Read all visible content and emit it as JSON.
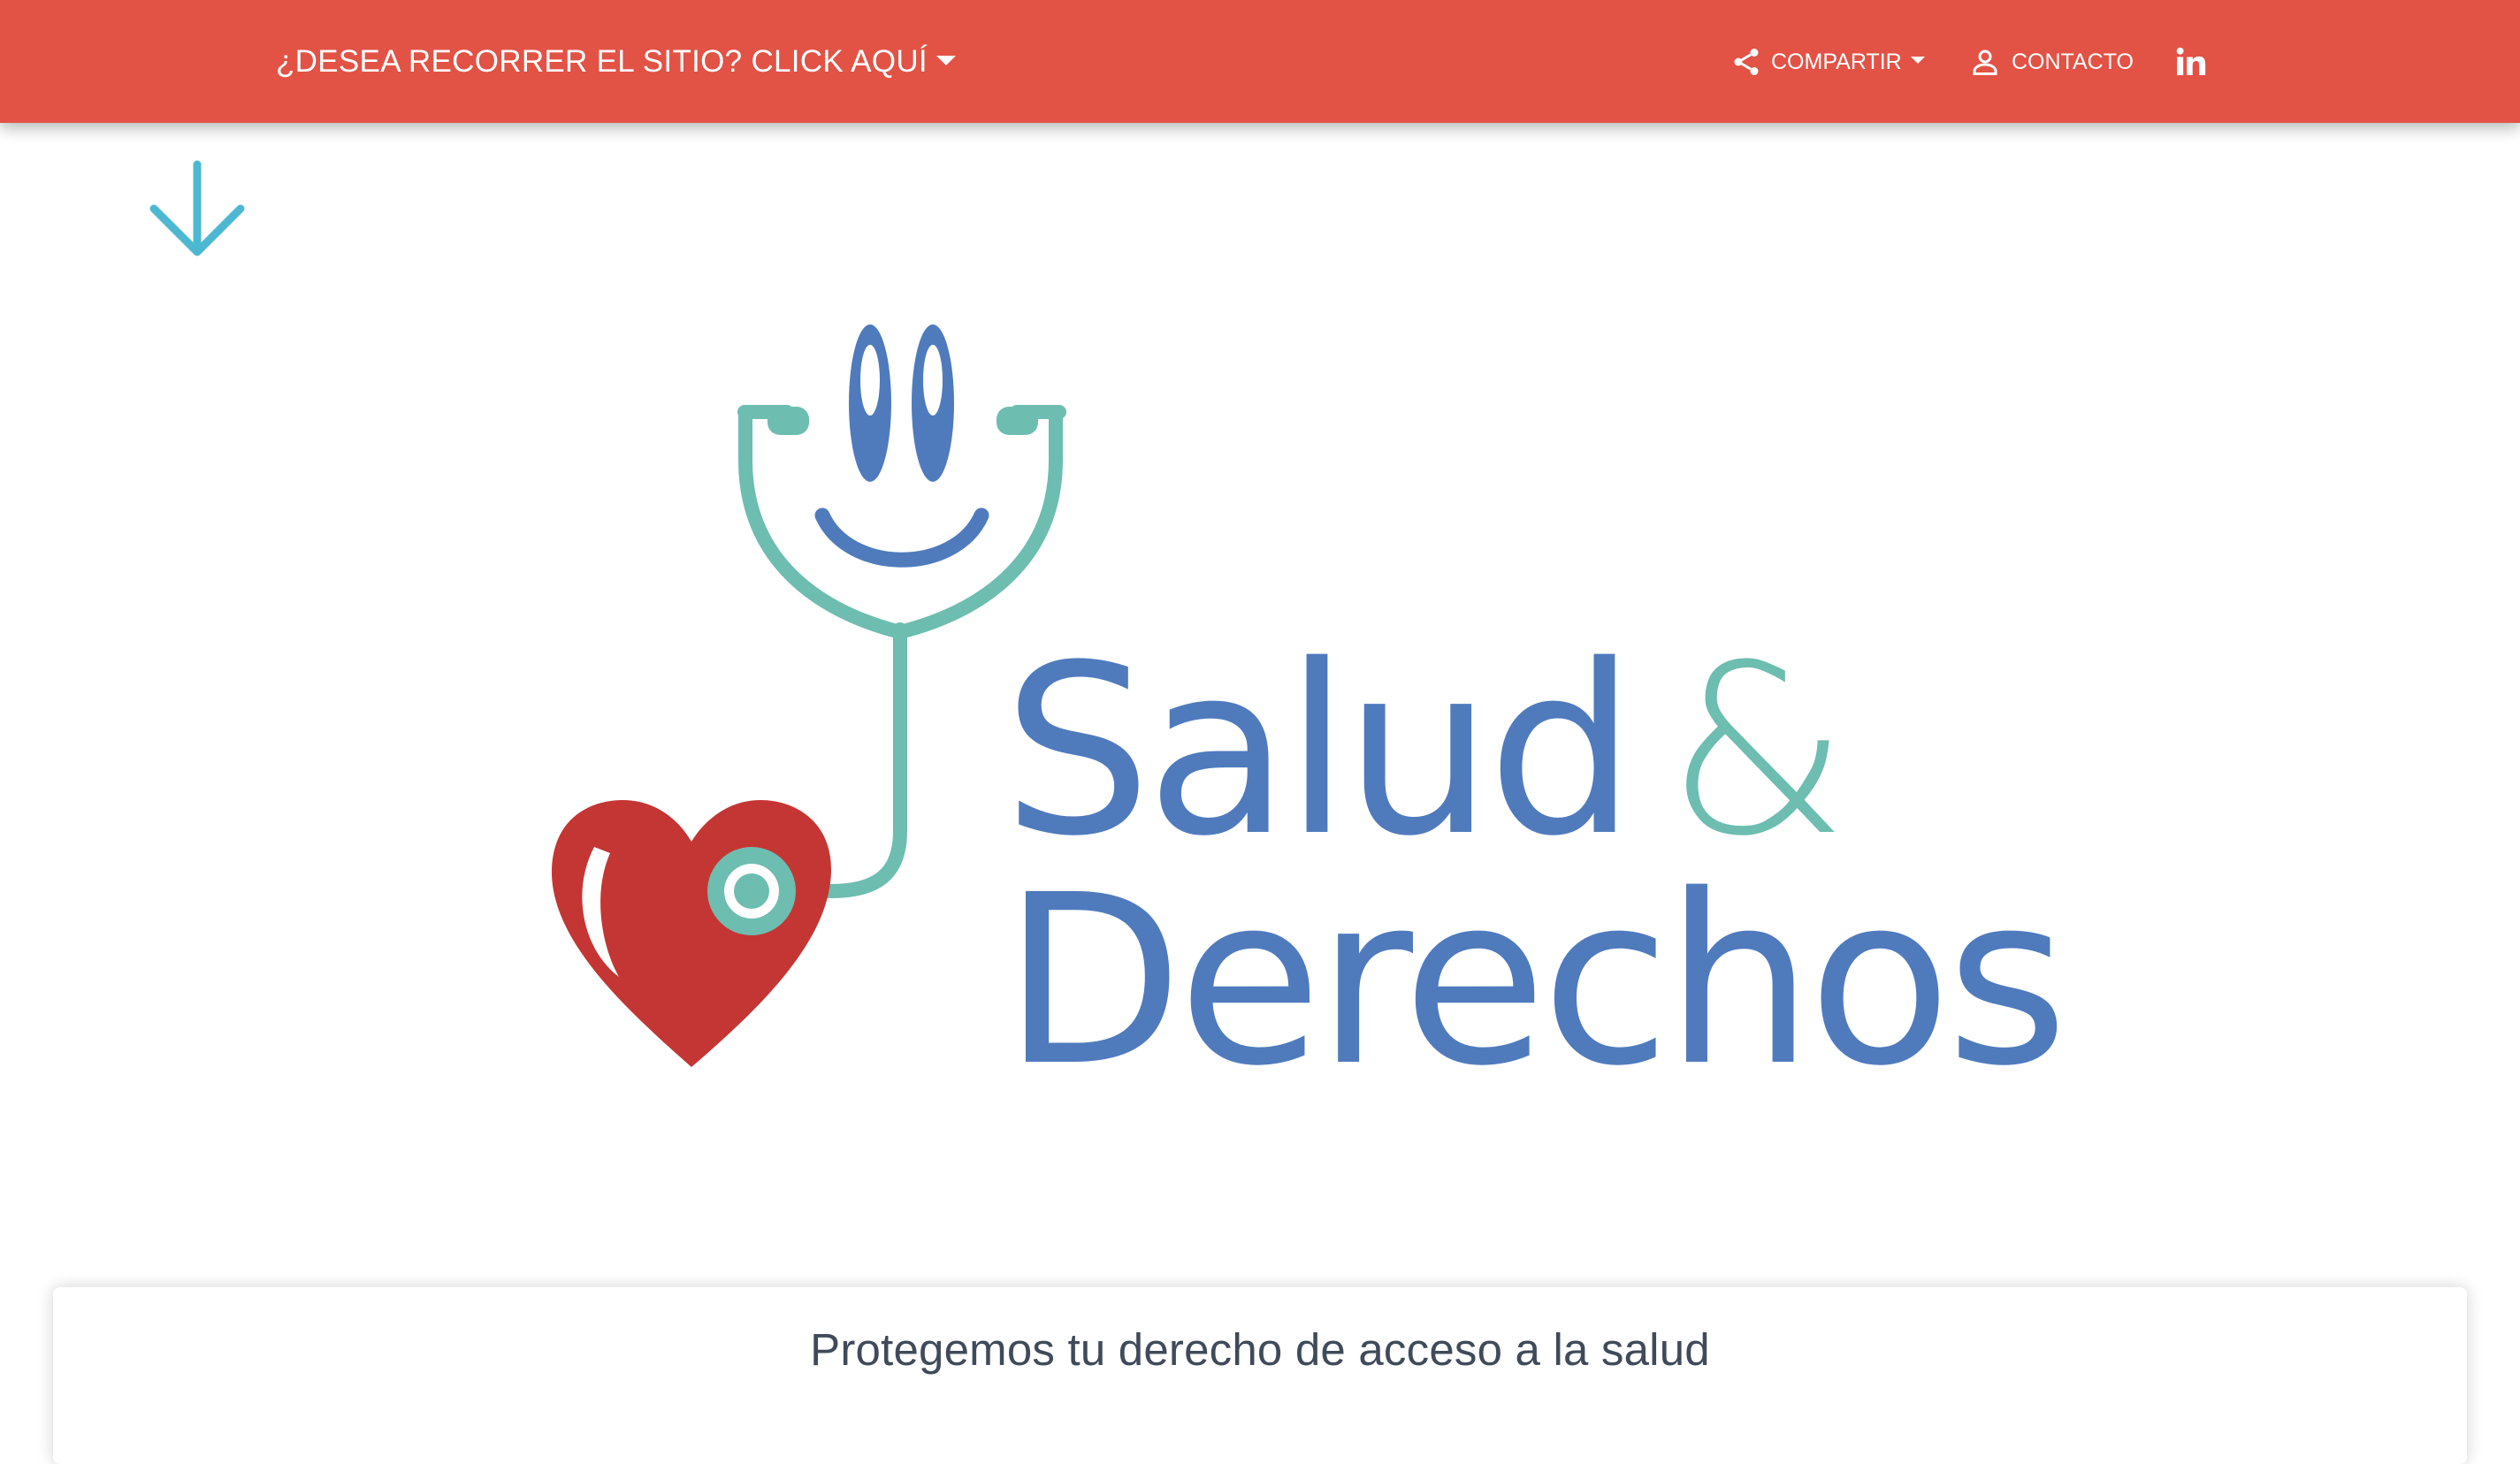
{
  "header": {
    "background_color": "#e25245",
    "tour_link_label": "¿DESEA RECORRER EL SITIO? CLICK AQUÍ",
    "share_label": "COMPARTIR",
    "share_icon": "share-icon",
    "contact_label": "CONTACTO",
    "contact_icon": "person-icon",
    "linkedin_icon": "linkedin-icon"
  },
  "scroll_indicator": {
    "icon": "arrow-down-icon",
    "color": "#4db8d1"
  },
  "logo": {
    "word_1": "Salud",
    "ampersand": "&",
    "word_2": "Derechos",
    "icon": "stethoscope-heart-smiley-icon",
    "colors": {
      "blue": "#4f7bbd",
      "teal": "#6dbdb0",
      "red": "#c43633"
    }
  },
  "intro": {
    "tagline": "Protegemos tu derecho de acceso a la salud"
  }
}
